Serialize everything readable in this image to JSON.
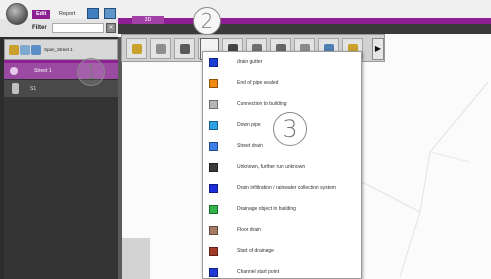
{
  "ribbon": {
    "tabs": [
      {
        "label": "Edit"
      },
      {
        "label": "Report"
      }
    ],
    "document_tab": "3D"
  },
  "filter": {
    "label": "Filter",
    "value": ""
  },
  "left_toolbar": {
    "label": "Span_Street 1"
  },
  "tree": {
    "items": [
      {
        "label": "Street 1",
        "selected": true
      },
      {
        "label": "S1",
        "selected": false
      }
    ]
  },
  "toolbar": {
    "buttons": [
      {
        "icon": "pipe-tool-icon",
        "color": "#c9a02c"
      },
      {
        "icon": "object-tool-icon",
        "color": "#8d8d8d"
      },
      {
        "icon": "shaft-tool-icon",
        "color": "#5a5a5a"
      },
      {
        "icon": "connection-tool-icon",
        "color": "#7a7a7a"
      },
      {
        "icon": "pipe-end-tool-icon",
        "color": "#444444"
      },
      {
        "icon": "valve-tool-icon",
        "color": "#6f6f6f"
      },
      {
        "icon": "bend-tool-icon",
        "color": "#666666"
      },
      {
        "icon": "delete-tool-icon",
        "color": "#8a8a8a"
      },
      {
        "icon": "measure-tool-icon",
        "color": "#4f7fb3"
      },
      {
        "icon": "label-tool-icon",
        "color": "#c9a02c"
      }
    ],
    "more_glyph": "▶"
  },
  "menu": {
    "items": [
      {
        "label": "drain gutter",
        "color": "#1b3fd6"
      },
      {
        "label": "End of pipe sealed",
        "color": "#f08a12"
      },
      {
        "label": "Connection to building",
        "color": "#b7b7b7"
      },
      {
        "label": "Down pipe",
        "color": "#2aa1e3"
      },
      {
        "label": "Street drain",
        "color": "#3d7ee8"
      },
      {
        "label": "Unknown, further run unknown",
        "color": "#3a3a3a"
      },
      {
        "label": "Drain infiltration / rainwater collection system",
        "color": "#1c2fd8"
      },
      {
        "label": "Drainage object in building",
        "color": "#31b34a"
      },
      {
        "label": "Floor drain",
        "color": "#a57b63"
      },
      {
        "label": "Start of drainage",
        "color": "#a23a2a"
      },
      {
        "label": "Channel start point",
        "color": "#1e39d4"
      }
    ]
  },
  "callouts": [
    "1",
    "2",
    "3"
  ]
}
